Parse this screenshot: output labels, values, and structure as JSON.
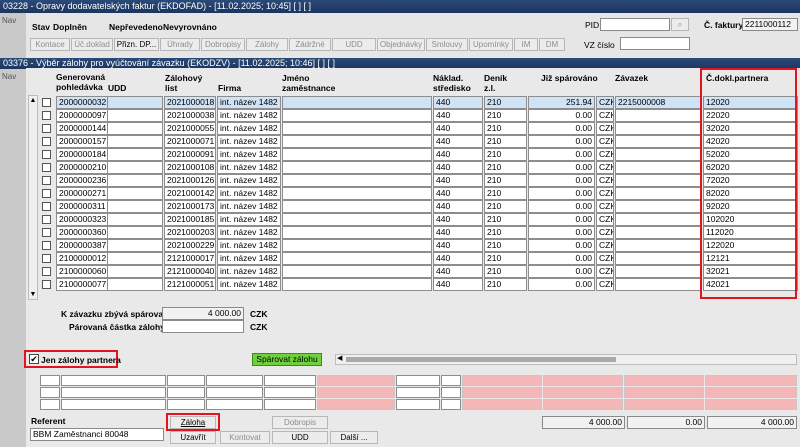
{
  "outer_window": {
    "title": "03228 - Opravy dodavatelských faktur (EKDOFAD) - [11.02.2025; 10:45]  [ ]  [ ]",
    "nav_label": "Nav",
    "stav_label": "Stav",
    "states": [
      "Doplněn",
      "Nepřevedeno",
      "Nevyrovnáno"
    ],
    "toolbar": [
      "Kontace",
      "Úč.doklad",
      "Přizn. DP...",
      "Úhrady",
      "Dobropisy",
      "Zálohy",
      "Zádržné",
      "UDD",
      "Objednávky",
      "Smlouvy",
      "Upomínky",
      "IM",
      "DM"
    ],
    "pid_label": "PID",
    "vz_label": "VZ číslo",
    "cfaktury_label": "Č. faktury",
    "cfaktury_value": "2211000112"
  },
  "inner_window": {
    "title": "03376 - Výběr zálohy pro vyúčtování závazku (EKODZV) - [11.02.2025; 10:46]  [ ]  [ ]",
    "nav_label": "Nav"
  },
  "table": {
    "headers": {
      "generovana": "Generovaná pohledávka",
      "udd": "UDD",
      "zalohovy": "Zálohový list",
      "firma": "Firma",
      "jmeno": "Jméno zaměstnance",
      "naklad": "Náklad. středisko",
      "denik": "Deník z.l.",
      "jiz": "Již spárováno",
      "zavazek": "Závazek",
      "cdokl": "Č.dokl.partnera"
    },
    "rows": [
      {
        "gen": "2000000032",
        "zal": "2021000018",
        "firma": "int. název 1482",
        "nak": "440",
        "den": "210",
        "jiz": "251.94",
        "cur": "CZK",
        "zav": "2215000008",
        "cd": "12020"
      },
      {
        "gen": "2000000097",
        "zal": "2021000038",
        "firma": "int. název 1482",
        "nak": "440",
        "den": "210",
        "jiz": "0.00",
        "cur": "CZK",
        "zav": "",
        "cd": "22020"
      },
      {
        "gen": "2000000144",
        "zal": "2021000055",
        "firma": "int. název 1482",
        "nak": "440",
        "den": "210",
        "jiz": "0.00",
        "cur": "CZK",
        "zav": "",
        "cd": "32020"
      },
      {
        "gen": "2000000157",
        "zal": "2021000071",
        "firma": "int. název 1482",
        "nak": "440",
        "den": "210",
        "jiz": "0.00",
        "cur": "CZK",
        "zav": "",
        "cd": "42020"
      },
      {
        "gen": "2000000184",
        "zal": "2021000091",
        "firma": "int. název 1482",
        "nak": "440",
        "den": "210",
        "jiz": "0.00",
        "cur": "CZK",
        "zav": "",
        "cd": "52020"
      },
      {
        "gen": "2000000210",
        "zal": "2021000108",
        "firma": "int. název 1482",
        "nak": "440",
        "den": "210",
        "jiz": "0.00",
        "cur": "CZK",
        "zav": "",
        "cd": "62020"
      },
      {
        "gen": "2000000236",
        "zal": "2021000126",
        "firma": "int. název 1482",
        "nak": "440",
        "den": "210",
        "jiz": "0.00",
        "cur": "CZK",
        "zav": "",
        "cd": "72020"
      },
      {
        "gen": "2000000271",
        "zal": "2021000142",
        "firma": "int. název 1482",
        "nak": "440",
        "den": "210",
        "jiz": "0.00",
        "cur": "CZK",
        "zav": "",
        "cd": "82020"
      },
      {
        "gen": "2000000311",
        "zal": "2021000173",
        "firma": "int. název 1482",
        "nak": "440",
        "den": "210",
        "jiz": "0.00",
        "cur": "CZK",
        "zav": "",
        "cd": "92020"
      },
      {
        "gen": "2000000323",
        "zal": "2021000185",
        "firma": "int. název 1482",
        "nak": "440",
        "den": "210",
        "jiz": "0.00",
        "cur": "CZK",
        "zav": "",
        "cd": "102020"
      },
      {
        "gen": "2000000360",
        "zal": "2021000203",
        "firma": "int. název 1482",
        "nak": "440",
        "den": "210",
        "jiz": "0.00",
        "cur": "CZK",
        "zav": "",
        "cd": "112020"
      },
      {
        "gen": "2000000387",
        "zal": "2021000229",
        "firma": "int. název 1482",
        "nak": "440",
        "den": "210",
        "jiz": "0.00",
        "cur": "CZK",
        "zav": "",
        "cd": "122020"
      },
      {
        "gen": "2100000012",
        "zal": "2121000017",
        "firma": "int. název 1482",
        "nak": "440",
        "den": "210",
        "jiz": "0.00",
        "cur": "CZK",
        "zav": "",
        "cd": "12121"
      },
      {
        "gen": "2100000060",
        "zal": "2121000040",
        "firma": "int. název 1482",
        "nak": "440",
        "den": "210",
        "jiz": "0.00",
        "cur": "CZK",
        "zav": "",
        "cd": "32021"
      },
      {
        "gen": "2100000077",
        "zal": "2121000051",
        "firma": "int. název 1482",
        "nak": "440",
        "den": "210",
        "jiz": "0.00",
        "cur": "CZK",
        "zav": "",
        "cd": "42021"
      }
    ]
  },
  "summary": {
    "k_zavazku_label": "K závazku zbývá spárovat",
    "k_zavazku_value": "4 000.00",
    "currency1": "CZK",
    "parovana_label": "Párovaná částka zálohy:",
    "parovana_value": "",
    "currency2": "CZK"
  },
  "filter": {
    "checkbox_label": "Jen zálohy partnera",
    "checked": true,
    "sparovat_label": "Spárovat zálohu"
  },
  "footer": {
    "referent_label": "Referent",
    "referent_value": "BBM Zaměstnanci 80048",
    "buttons": {
      "zaloha": "Záloha",
      "dobropis": "Dobropis",
      "uzavrit": "Uzavřít",
      "kontovat": "Kontovat",
      "udd": "UDD",
      "dalsi": "Další ..."
    },
    "totals": [
      "4 000.00",
      "0.00",
      "4 000.00"
    ]
  },
  "colors": {
    "highlight": "#e3141d",
    "green_button": "#6fd13a",
    "title_bar": "#1c3560",
    "selected_row": "#cfe2f6"
  }
}
